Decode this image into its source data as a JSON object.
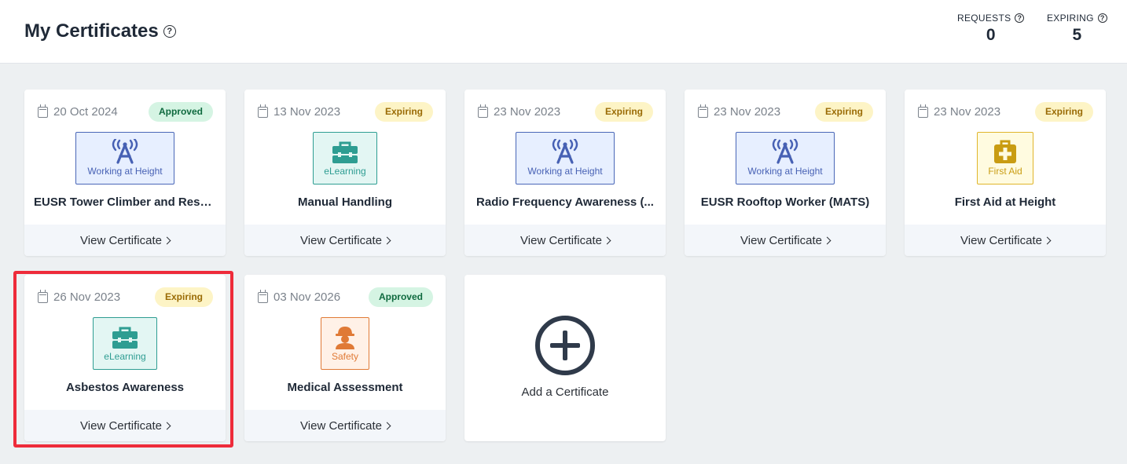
{
  "header": {
    "title": "My Certificates",
    "help_symbol": "?",
    "stats": [
      {
        "label": "REQUESTS",
        "value": "0"
      },
      {
        "label": "EXPIRING",
        "value": "5"
      }
    ]
  },
  "colors": {
    "approved_bg": "#d5f4e3",
    "approved_text": "#0f6a3f",
    "expiring_bg": "#fdf4c6",
    "expiring_text": "#9a6b05",
    "highlight": "#ee2b3a"
  },
  "certificates": [
    {
      "date": "20 Oct 2024",
      "status": "Approved",
      "category": "Working at Height",
      "category_icon": "radio-tower-icon",
      "name": "EUSR Tower Climber and Resc...",
      "action": "View Certificate"
    },
    {
      "date": "13 Nov 2023",
      "status": "Expiring",
      "category": "eLearning",
      "category_icon": "toolbox-icon",
      "name": "Manual Handling",
      "action": "View Certificate"
    },
    {
      "date": "23 Nov 2023",
      "status": "Expiring",
      "category": "Working at Height",
      "category_icon": "radio-tower-icon",
      "name": "Radio Frequency Awareness (...",
      "action": "View Certificate"
    },
    {
      "date": "23 Nov 2023",
      "status": "Expiring",
      "category": "Working at Height",
      "category_icon": "radio-tower-icon",
      "name": "EUSR Rooftop Worker (MATS)",
      "action": "View Certificate"
    },
    {
      "date": "23 Nov 2023",
      "status": "Expiring",
      "category": "First Aid",
      "category_icon": "first-aid-kit-icon",
      "name": "First Aid at Height",
      "action": "View Certificate"
    },
    {
      "date": "26 Nov 2023",
      "status": "Expiring",
      "category": "eLearning",
      "category_icon": "toolbox-icon",
      "name": "Asbestos Awareness",
      "action": "View Certificate"
    },
    {
      "date": "03 Nov 2026",
      "status": "Approved",
      "category": "Safety",
      "category_icon": "hard-hat-worker-icon",
      "name": "Medical Assessment",
      "action": "View Certificate"
    }
  ],
  "add_card": {
    "label": "Add a Certificate",
    "icon": "plus-circle-icon"
  }
}
